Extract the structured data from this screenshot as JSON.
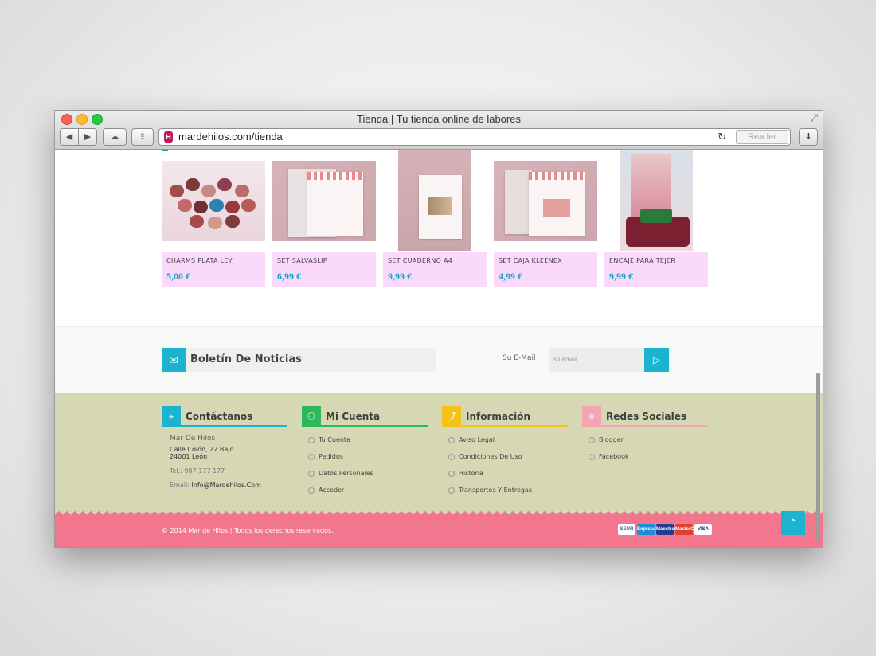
{
  "window": {
    "title": "Tienda | Tu tienda online de labores",
    "url": "mardehilos.com/tienda",
    "reader_label": "Reader"
  },
  "products": [
    {
      "name": "CHARMS PLATA LEY",
      "price": "5,00 €"
    },
    {
      "name": "SET SALVASLIP",
      "price": "6,99 €"
    },
    {
      "name": "SET CUADERNO A4",
      "price": "9,99 €"
    },
    {
      "name": "SET CAJA KLEENEX",
      "price": "4,99 €"
    },
    {
      "name": "ENCAJE PARA TEJER",
      "price": "9,99 €"
    }
  ],
  "newsletter": {
    "title": "Boletín De Noticias",
    "email_label": "Su E-Mail",
    "placeholder": "su email"
  },
  "footer": {
    "contact": {
      "title": "Contáctanos",
      "company": "Mar De Hilos",
      "address1": "Calle Colón, 22 Bajo",
      "address2": "24001 León",
      "phone": "Tel.: 987 177 177",
      "email_label": "Email:",
      "email": "Info@Mardehilos.Com"
    },
    "account": {
      "title": "Mi Cuenta",
      "items": [
        "Tu Cuenta",
        "Pedidos",
        "Datos Personales",
        "Acceder"
      ]
    },
    "info": {
      "title": "Información",
      "items": [
        "Aviso Legal",
        "Condiciones De Uso",
        "Historia",
        "Transportes Y Entregas"
      ]
    },
    "social": {
      "title": "Redes Sociales",
      "items": [
        "Blogger",
        "Facebook"
      ]
    },
    "copyright": "© 2014 Mar de Hilos | Todos los derechos reservados.",
    "payment_cards": [
      "SEUR",
      "Express",
      "Maestro",
      "MasterCard",
      "VISA"
    ]
  },
  "colors": {
    "accent": "#1bb3cf",
    "product_bg": "#fad9fa",
    "price": "#19a3c7",
    "footer_bg": "#d6d8b4",
    "bottom_bar": "#f2768d",
    "contact_accent": "#1bb3cf",
    "account_accent": "#2db85a",
    "info_accent": "#f5c21a",
    "social_accent": "#f6a3b3"
  }
}
